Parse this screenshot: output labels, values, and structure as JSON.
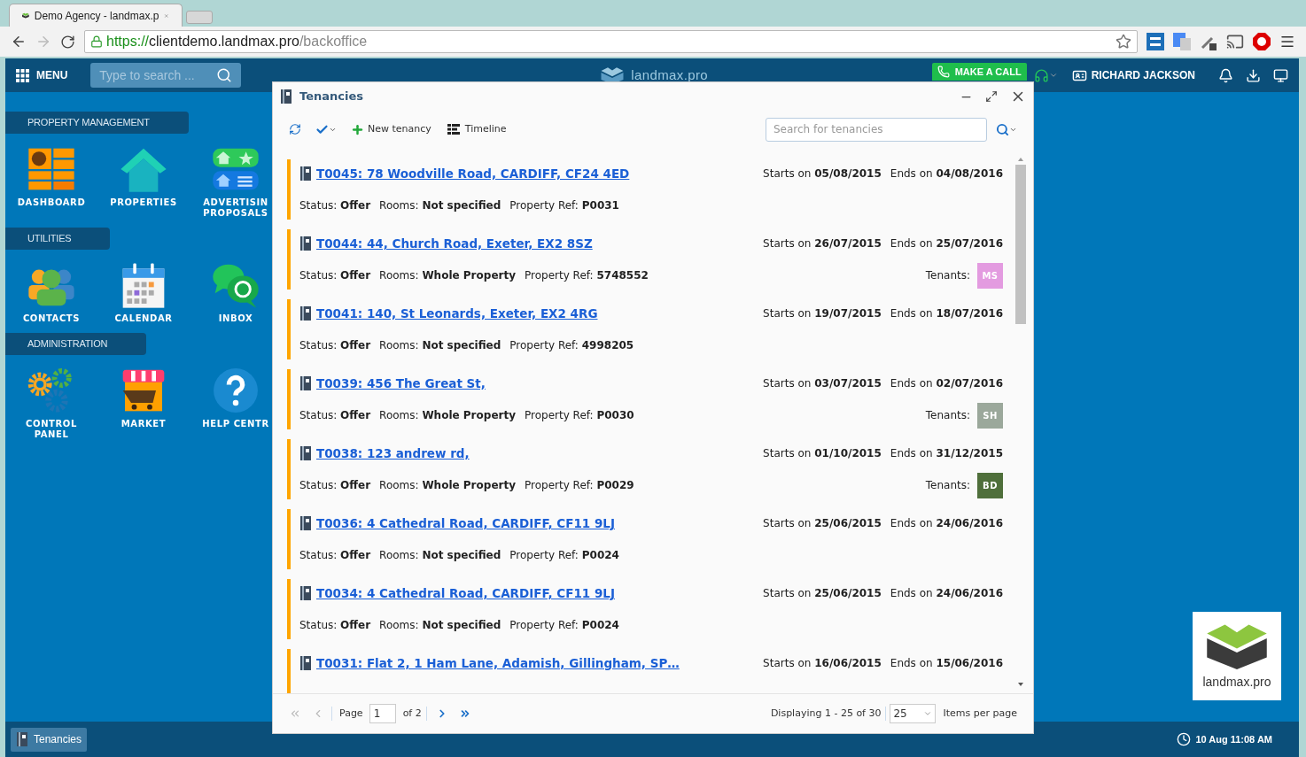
{
  "browser": {
    "tab": {
      "title": "Demo Agency - landmax.p"
    },
    "url": {
      "scheme": "https://",
      "host": "clientdemo.landmax.pro",
      "path": "/backoffice"
    }
  },
  "header": {
    "menu": "MENU",
    "search": {
      "placeholder": "Type to search ..."
    },
    "logo": "landmax.pro",
    "call_button": "MAKE A CALL",
    "user": "RICHARD JACKSON"
  },
  "sections": [
    {
      "title": "PROPERTY MANAGEMENT",
      "tiles": [
        {
          "kind": "dashboard",
          "label": [
            "DASHBOARD"
          ]
        },
        {
          "kind": "properties",
          "label": [
            "PROPERTIES"
          ]
        },
        {
          "kind": "advertising",
          "label": [
            "ADVERTISIN",
            "PROPOSALS"
          ]
        }
      ]
    },
    {
      "title": "UTILITIES",
      "tiles": [
        {
          "kind": "contacts",
          "label": [
            "CONTACTS"
          ]
        },
        {
          "kind": "calendar",
          "label": [
            "CALENDAR"
          ]
        },
        {
          "kind": "inbox",
          "label": [
            "INBOX"
          ]
        }
      ]
    },
    {
      "title": "ADMINISTRATION",
      "tiles": [
        {
          "kind": "control",
          "label": [
            "CONTROL",
            "PANEL"
          ]
        },
        {
          "kind": "market",
          "label": [
            "MARKET"
          ]
        },
        {
          "kind": "help",
          "label": [
            "HELP CENTR"
          ]
        }
      ]
    }
  ],
  "window": {
    "title": "Tenancies",
    "toolbar": {
      "new": "New tenancy",
      "timeline": "Timeline",
      "search": {
        "placeholder": "Search for tenancies"
      }
    },
    "rows": [
      {
        "title": "T0045: 78 Woodville Road, CARDIFF, CF24 4ED",
        "starts": "Starts on **05/08/2015**",
        "ends": "Ends on **04/08/2016**",
        "status": "Status: **Offer**",
        "rooms": "Rooms: **Not specified**",
        "ref": "Property Ref: **P0031**"
      },
      {
        "title": "T0044: 44, Church Road, Exeter, EX2 8SZ",
        "starts": "Starts on **26/07/2015**",
        "ends": "Ends on **25/07/2016**",
        "status": "Status: **Offer**",
        "rooms": "Rooms: **Whole Property**",
        "ref": "Property Ref: **5748552**",
        "tenants_label": "Tenants:",
        "tenants": [
          {
            "initials": "MS",
            "color": "#e39be0"
          }
        ]
      },
      {
        "title": "T0041: 140, St Leonards, Exeter, EX2 4RG",
        "starts": "Starts on **19/07/2015**",
        "ends": "Ends on **18/07/2016**",
        "status": "Status: **Offer**",
        "rooms": "Rooms: **Not specified**",
        "ref": "Property Ref: **4998205**"
      },
      {
        "title": "T0039: 456 The Great St,",
        "starts": "Starts on **03/07/2015**",
        "ends": "Ends on **02/07/2016**",
        "status": "Status: **Offer**",
        "rooms": "Rooms: **Whole Property**",
        "ref": "Property Ref: **P0030**",
        "tenants_label": "Tenants:",
        "tenants": [
          {
            "initials": "SH",
            "color": "#9ba89b"
          }
        ]
      },
      {
        "title": "T0038: 123 andrew rd,",
        "starts": "Starts on **01/10/2015**",
        "ends": "Ends on **31/12/2015**",
        "status": "Status: **Offer**",
        "rooms": "Rooms: **Whole Property**",
        "ref": "Property Ref: **P0029**",
        "tenants_label": "Tenants:",
        "tenants": [
          {
            "initials": "BD",
            "color": "#4f6f3b"
          }
        ]
      },
      {
        "title": "T0036: 4 Cathedral Road, CARDIFF, CF11 9LJ",
        "starts": "Starts on **25/06/2015**",
        "ends": "Ends on **24/06/2016**",
        "status": "Status: **Offer**",
        "rooms": "Rooms: **Not specified**",
        "ref": "Property Ref: **P0024**"
      },
      {
        "title": "T0034: 4 Cathedral Road, CARDIFF, CF11 9LJ",
        "starts": "Starts on **25/06/2015**",
        "ends": "Ends on **24/06/2016**",
        "status": "Status: **Offer**",
        "rooms": "Rooms: **Not specified**",
        "ref": "Property Ref: **P0024**"
      },
      {
        "title": "T0031: Flat 2, 1 Ham Lane, Adamish, Gillingham, SP…",
        "starts": "Starts on **16/06/2015**",
        "ends": "Ends on **15/06/2016**"
      }
    ],
    "pager": {
      "page_label": "Page",
      "page": "1",
      "of": "of 2",
      "displaying": "Displaying 1 - 25 of 30",
      "per_page": "25",
      "per_page_label": "Items per page"
    }
  },
  "taskbar": {
    "items": [
      {
        "label": "Tenancies",
        "selected": true
      }
    ],
    "clock": "10 Aug 11:08 AM"
  },
  "corner_logo": {
    "text": "landmax.pro"
  }
}
